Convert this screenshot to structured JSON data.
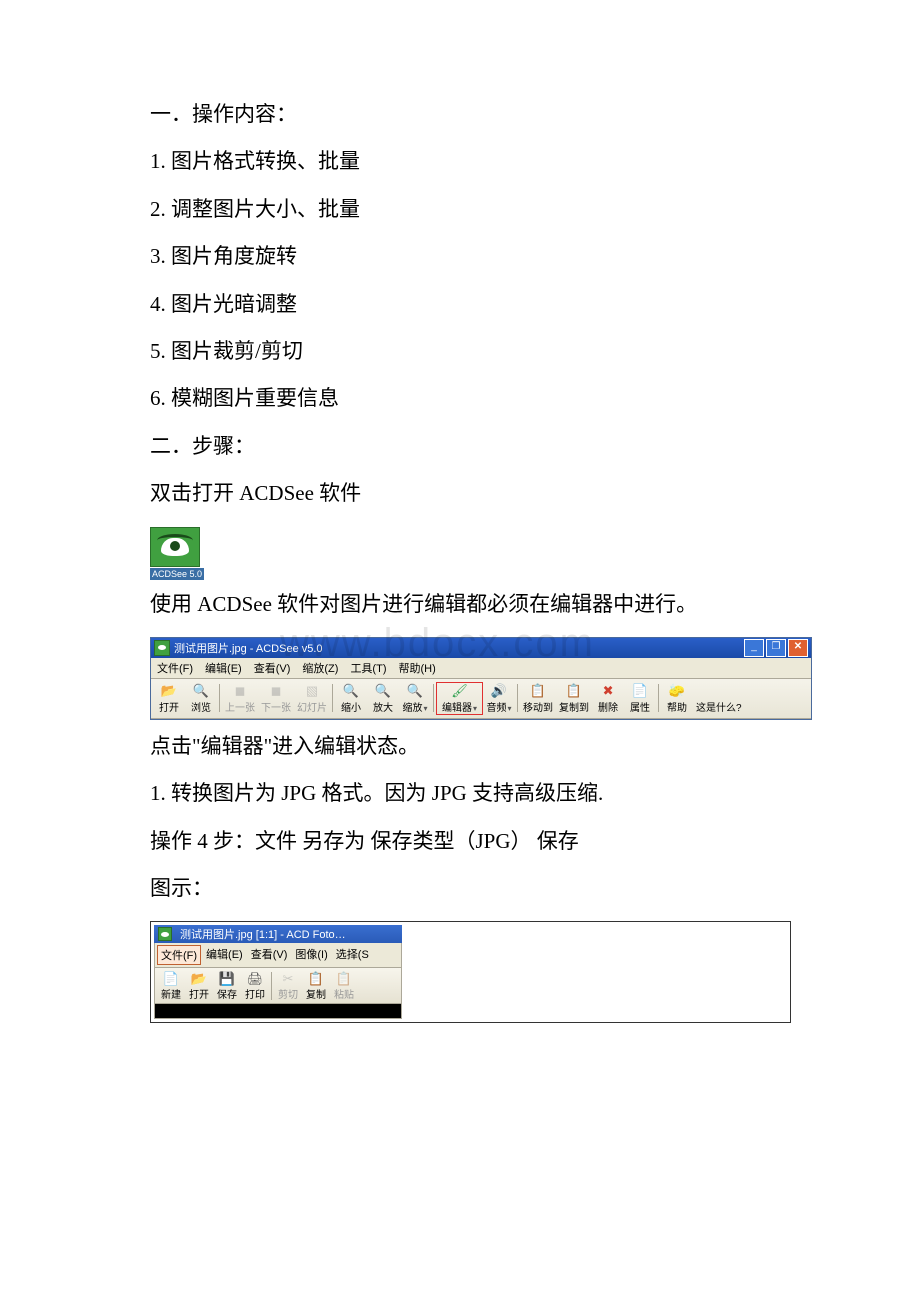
{
  "text": {
    "heading1": "一．操作内容：",
    "item1": "1. 图片格式转换、批量",
    "item2": "2. 调整图片大小、批量",
    "item3": "3. 图片角度旋转",
    "item4": "4. 图片光暗调整",
    "item5": "5. 图片裁剪/剪切",
    "item6": "6. 模糊图片重要信息",
    "heading2": "二．步骤：",
    "step_open": "双击打开 ACDSee 软件",
    "desktop_icon_label": "ACDSee 5.0",
    "step_editor": "使用 ACDSee 软件对图片进行编辑都必须在编辑器中进行。",
    "step_click": "点击\"编辑器\"进入编辑状态。",
    "step_convert": "1. 转换图片为 JPG 格式。因为 JPG 支持高级压缩.",
    "step_4steps": "操作 4 步：文件  另存为  保存类型（JPG） 保存",
    "step_tushi": "图示："
  },
  "watermark": "www.bdocx.com",
  "acdsee_viewer": {
    "title": "测试用图片.jpg - ACDSee v5.0",
    "menus": [
      "文件(F)",
      "编辑(E)",
      "查看(V)",
      "缩放(Z)",
      "工具(T)",
      "帮助(H)"
    ],
    "toolbar": [
      {
        "icon": "📂",
        "label": "打开",
        "name": "open-button",
        "color": "#d8a030"
      },
      {
        "icon": "🔍",
        "label": "浏览",
        "name": "browse-button",
        "color": "#507030"
      },
      {
        "sep": true
      },
      {
        "icon": "◼",
        "label": "上一张",
        "name": "prev-button",
        "disabled": true
      },
      {
        "icon": "◼",
        "label": "下一张",
        "name": "next-button",
        "disabled": true
      },
      {
        "icon": "▧",
        "label": "幻灯片",
        "name": "slideshow-button",
        "disabled": true
      },
      {
        "sep": true
      },
      {
        "icon": "🔍",
        "label": "缩小",
        "name": "zoom-out-button",
        "color": "#888"
      },
      {
        "icon": "🔍",
        "label": "放大",
        "name": "zoom-in-button",
        "color": "#888"
      },
      {
        "icon": "🔍",
        "label": "缩放",
        "name": "zoom-button",
        "color": "#888",
        "dropdown": true
      },
      {
        "sep": true
      },
      {
        "icon": "🖌",
        "label": "编辑器",
        "name": "editor-button",
        "color": "#30a050",
        "highlight": true,
        "dropdown": true
      },
      {
        "icon": "🔊",
        "label": "音频",
        "name": "audio-button",
        "color": "#d8a030",
        "dropdown": true
      },
      {
        "sep": true
      },
      {
        "icon": "📋",
        "label": "移动到",
        "name": "move-to-button",
        "color": "#7090c0"
      },
      {
        "icon": "📋",
        "label": "复制到",
        "name": "copy-to-button",
        "color": "#7090c0"
      },
      {
        "icon": "✖",
        "label": "删除",
        "name": "delete-button",
        "color": "#d04030"
      },
      {
        "icon": "📄",
        "label": "属性",
        "name": "properties-button",
        "color": "#d8c050"
      },
      {
        "sep": true
      },
      {
        "icon": "🧽",
        "label": "帮助",
        "name": "help-button",
        "color": "#d070b0"
      },
      {
        "icon": "",
        "label": "这是什么?",
        "name": "whats-this-button"
      }
    ]
  },
  "acdsee_editor": {
    "title": "测试用图片.jpg [1:1] - ACD Foto…",
    "menus": [
      {
        "label": "文件(F)",
        "selected": true
      },
      {
        "label": "编辑(E)"
      },
      {
        "label": "查看(V)"
      },
      {
        "label": "图像(I)"
      },
      {
        "label": "选择(S"
      }
    ],
    "toolbar": [
      {
        "icon": "📄",
        "label": "新建",
        "name": "new-button",
        "color": "#fff"
      },
      {
        "icon": "📂",
        "label": "打开",
        "name": "open-button",
        "color": "#d8a030"
      },
      {
        "icon": "💾",
        "label": "保存",
        "name": "save-button",
        "color": "#4060a0"
      },
      {
        "icon": "🖨",
        "label": "打印",
        "name": "print-button",
        "color": "#555"
      },
      {
        "sep": true
      },
      {
        "icon": "✂",
        "label": "剪切",
        "name": "cut-button",
        "disabled": true
      },
      {
        "icon": "📋",
        "label": "复制",
        "name": "copy-button",
        "color": "#d8a030"
      },
      {
        "icon": "📋",
        "label": "粘贴",
        "name": "paste-button",
        "disabled": true
      }
    ]
  }
}
